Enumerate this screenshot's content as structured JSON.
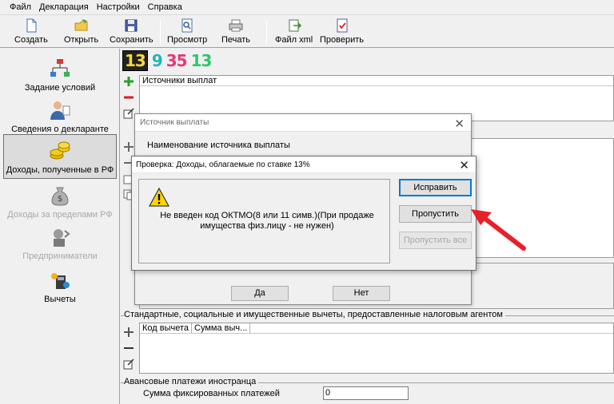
{
  "menu": [
    "Файл",
    "Декларация",
    "Настройки",
    "Справка"
  ],
  "toolbar": {
    "create": "Создать",
    "open": "Открыть",
    "save": "Сохранить",
    "preview": "Просмотр",
    "print": "Печать",
    "xml_file": "Файл xml",
    "check": "Проверить"
  },
  "sidebar": {
    "items": [
      {
        "label": "Задание условий",
        "icon": "conditions-tree-icon",
        "state": "normal"
      },
      {
        "label": "Сведения о декларанте",
        "icon": "declarant-person-icon",
        "state": "normal"
      },
      {
        "label": "Доходы, полученные в РФ",
        "icon": "coins-icon",
        "state": "active"
      },
      {
        "label": "Доходы за пределами РФ",
        "icon": "money-bag-icon",
        "state": "disabled"
      },
      {
        "label": "Предприниматели",
        "icon": "entrepreneur-icon",
        "state": "disabled"
      },
      {
        "label": "Вычеты",
        "icon": "calculator-icon",
        "state": "normal"
      }
    ]
  },
  "tax_rates": [
    "13",
    "9",
    "35",
    "13"
  ],
  "rate_colors": {
    "selected": "#ffd83a",
    "r9": "#1fb7b7",
    "r35": "#e33a79",
    "r13": "#2fc76b"
  },
  "sources_panel": {
    "header": "Источники выплат"
  },
  "deductions": {
    "group_label": "Стандартные, социальные и имущественные вычеты, предоставленные налоговым агентом",
    "columns": [
      "Код вычета",
      "Сумма выч..."
    ]
  },
  "advance": {
    "group_label": "Авансовые платежи иностранца",
    "field_label": "Сумма фиксированных платежей",
    "field_value": "0"
  },
  "source_dialog": {
    "title": "Источник выплаты",
    "label": "Наименование источника выплаты",
    "yes": "Да",
    "no": "Нет"
  },
  "check_dialog": {
    "title": "Проверка: Доходы, облагаемые по ставке 13%",
    "message": "Не введен код ОКТМО(8 или 11 симв.)(При продаже имущества физ.лицу - не нужен)",
    "fix": "Исправить",
    "skip": "Пропустить",
    "skip_all": "Пропустить все"
  },
  "accent_colors": {
    "arrow": "#e8202a",
    "focus": "#0078d7"
  }
}
